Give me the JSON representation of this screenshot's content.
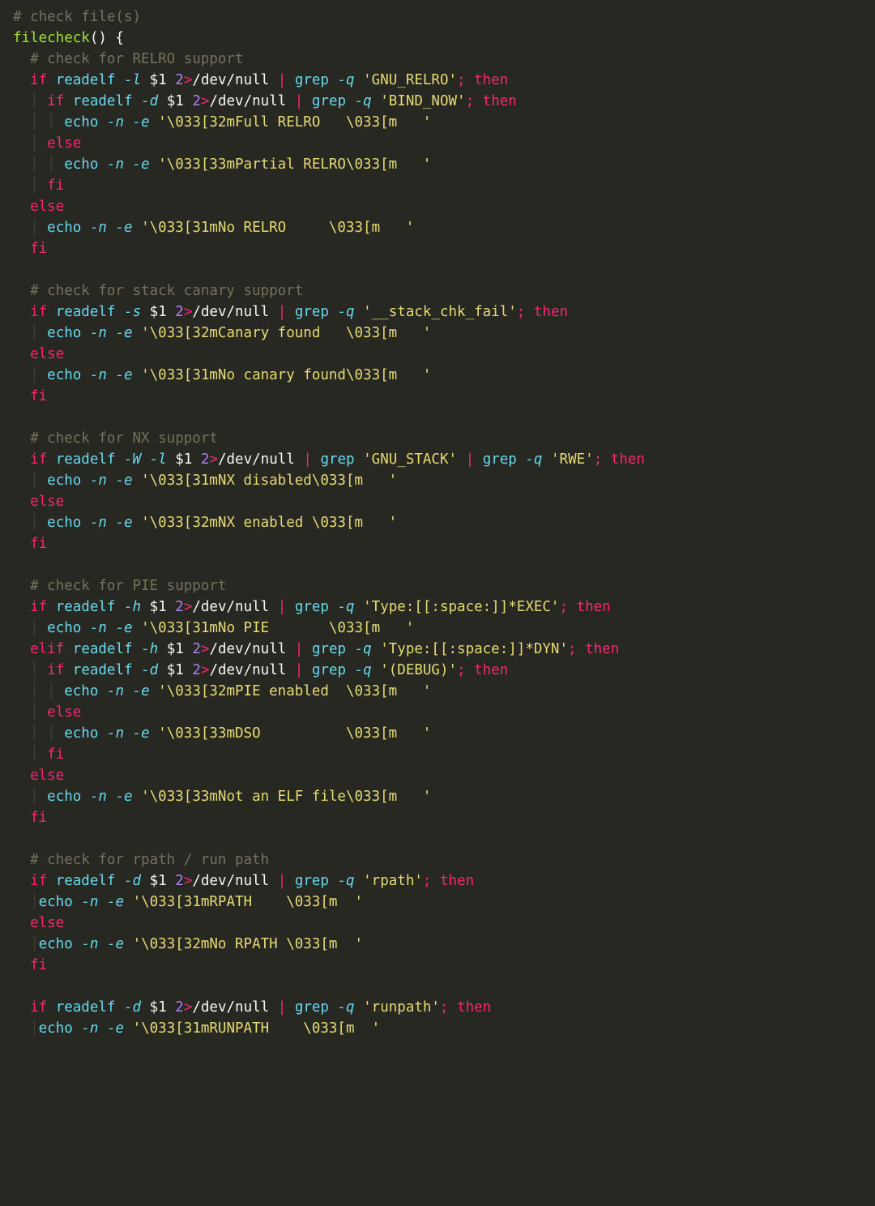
{
  "lines": [
    [
      [
        "c-comment",
        "# check file(s)"
      ]
    ],
    [
      [
        "c-func",
        "filecheck"
      ],
      [
        "c-white",
        "() {"
      ]
    ],
    [
      [
        "guide",
        "  "
      ],
      [
        "c-comment",
        "# check for RELRO support"
      ]
    ],
    [
      [
        "guide",
        "  "
      ],
      [
        "c-kw",
        "if"
      ],
      [
        "c-white",
        " "
      ],
      [
        "c-cmd",
        "readelf"
      ],
      [
        "c-white",
        " "
      ],
      [
        "c-flag",
        "-l"
      ],
      [
        "c-white",
        " "
      ],
      [
        "c-var",
        "$1"
      ],
      [
        "c-white",
        " "
      ],
      [
        "c-num",
        "2"
      ],
      [
        "c-op",
        ">"
      ],
      [
        "c-white",
        "/dev/null "
      ],
      [
        "c-op",
        "|"
      ],
      [
        "c-white",
        " "
      ],
      [
        "c-cmd",
        "grep"
      ],
      [
        "c-white",
        " "
      ],
      [
        "c-flag",
        "-q"
      ],
      [
        "c-white",
        " "
      ],
      [
        "c-str",
        "'GNU_RELRO'"
      ],
      [
        "c-op",
        ";"
      ],
      [
        "c-white",
        " "
      ],
      [
        "c-kw",
        "then"
      ]
    ],
    [
      [
        "guide",
        "  | "
      ],
      [
        "c-kw",
        "if"
      ],
      [
        "c-white",
        " "
      ],
      [
        "c-cmd",
        "readelf"
      ],
      [
        "c-white",
        " "
      ],
      [
        "c-flag",
        "-d"
      ],
      [
        "c-white",
        " "
      ],
      [
        "c-var",
        "$1"
      ],
      [
        "c-white",
        " "
      ],
      [
        "c-num",
        "2"
      ],
      [
        "c-op",
        ">"
      ],
      [
        "c-white",
        "/dev/null "
      ],
      [
        "c-op",
        "|"
      ],
      [
        "c-white",
        " "
      ],
      [
        "c-cmd",
        "grep"
      ],
      [
        "c-white",
        " "
      ],
      [
        "c-flag",
        "-q"
      ],
      [
        "c-white",
        " "
      ],
      [
        "c-str",
        "'BIND_NOW'"
      ],
      [
        "c-op",
        ";"
      ],
      [
        "c-white",
        " "
      ],
      [
        "c-kw",
        "then"
      ]
    ],
    [
      [
        "guide",
        "  | | "
      ],
      [
        "c-cmd",
        "echo"
      ],
      [
        "c-white",
        " "
      ],
      [
        "c-flag",
        "-n"
      ],
      [
        "c-white",
        " "
      ],
      [
        "c-flag",
        "-e"
      ],
      [
        "c-white",
        " "
      ],
      [
        "c-str",
        "'\\033[32mFull RELRO   \\033[m   '"
      ]
    ],
    [
      [
        "guide",
        "  | "
      ],
      [
        "c-kw",
        "else"
      ]
    ],
    [
      [
        "guide",
        "  | | "
      ],
      [
        "c-cmd",
        "echo"
      ],
      [
        "c-white",
        " "
      ],
      [
        "c-flag",
        "-n"
      ],
      [
        "c-white",
        " "
      ],
      [
        "c-flag",
        "-e"
      ],
      [
        "c-white",
        " "
      ],
      [
        "c-str",
        "'\\033[33mPartial RELRO\\033[m   '"
      ]
    ],
    [
      [
        "guide",
        "  | "
      ],
      [
        "c-kw",
        "fi"
      ]
    ],
    [
      [
        "guide",
        "  "
      ],
      [
        "c-kw",
        "else"
      ]
    ],
    [
      [
        "guide",
        "  | "
      ],
      [
        "c-cmd",
        "echo"
      ],
      [
        "c-white",
        " "
      ],
      [
        "c-flag",
        "-n"
      ],
      [
        "c-white",
        " "
      ],
      [
        "c-flag",
        "-e"
      ],
      [
        "c-white",
        " "
      ],
      [
        "c-str",
        "'\\033[31mNo RELRO     \\033[m   '"
      ]
    ],
    [
      [
        "guide",
        "  "
      ],
      [
        "c-kw",
        "fi"
      ]
    ],
    [
      [
        "c-white",
        " "
      ]
    ],
    [
      [
        "guide",
        "  "
      ],
      [
        "c-comment",
        "# check for stack canary support"
      ]
    ],
    [
      [
        "guide",
        "  "
      ],
      [
        "c-kw",
        "if"
      ],
      [
        "c-white",
        " "
      ],
      [
        "c-cmd",
        "readelf"
      ],
      [
        "c-white",
        " "
      ],
      [
        "c-flag",
        "-s"
      ],
      [
        "c-white",
        " "
      ],
      [
        "c-var",
        "$1"
      ],
      [
        "c-white",
        " "
      ],
      [
        "c-num",
        "2"
      ],
      [
        "c-op",
        ">"
      ],
      [
        "c-white",
        "/dev/null "
      ],
      [
        "c-op",
        "|"
      ],
      [
        "c-white",
        " "
      ],
      [
        "c-cmd",
        "grep"
      ],
      [
        "c-white",
        " "
      ],
      [
        "c-flag",
        "-q"
      ],
      [
        "c-white",
        " "
      ],
      [
        "c-str",
        "'__stack_chk_fail'"
      ],
      [
        "c-op",
        ";"
      ],
      [
        "c-white",
        " "
      ],
      [
        "c-kw",
        "then"
      ]
    ],
    [
      [
        "guide",
        "  | "
      ],
      [
        "c-cmd",
        "echo"
      ],
      [
        "c-white",
        " "
      ],
      [
        "c-flag",
        "-n"
      ],
      [
        "c-white",
        " "
      ],
      [
        "c-flag",
        "-e"
      ],
      [
        "c-white",
        " "
      ],
      [
        "c-str",
        "'\\033[32mCanary found   \\033[m   '"
      ]
    ],
    [
      [
        "guide",
        "  "
      ],
      [
        "c-kw",
        "else"
      ]
    ],
    [
      [
        "guide",
        "  | "
      ],
      [
        "c-cmd",
        "echo"
      ],
      [
        "c-white",
        " "
      ],
      [
        "c-flag",
        "-n"
      ],
      [
        "c-white",
        " "
      ],
      [
        "c-flag",
        "-e"
      ],
      [
        "c-white",
        " "
      ],
      [
        "c-str",
        "'\\033[31mNo canary found\\033[m   '"
      ]
    ],
    [
      [
        "guide",
        "  "
      ],
      [
        "c-kw",
        "fi"
      ]
    ],
    [
      [
        "c-white",
        " "
      ]
    ],
    [
      [
        "guide",
        "  "
      ],
      [
        "c-comment",
        "# check for NX support"
      ]
    ],
    [
      [
        "guide",
        "  "
      ],
      [
        "c-kw",
        "if"
      ],
      [
        "c-white",
        " "
      ],
      [
        "c-cmd",
        "readelf"
      ],
      [
        "c-white",
        " "
      ],
      [
        "c-flag",
        "-W"
      ],
      [
        "c-white",
        " "
      ],
      [
        "c-flag",
        "-l"
      ],
      [
        "c-white",
        " "
      ],
      [
        "c-var",
        "$1"
      ],
      [
        "c-white",
        " "
      ],
      [
        "c-num",
        "2"
      ],
      [
        "c-op",
        ">"
      ],
      [
        "c-white",
        "/dev/null "
      ],
      [
        "c-op",
        "|"
      ],
      [
        "c-white",
        " "
      ],
      [
        "c-cmd",
        "grep"
      ],
      [
        "c-white",
        " "
      ],
      [
        "c-str",
        "'GNU_STACK'"
      ],
      [
        "c-white",
        " "
      ],
      [
        "c-op",
        "|"
      ],
      [
        "c-white",
        " "
      ],
      [
        "c-cmd",
        "grep"
      ],
      [
        "c-white",
        " "
      ],
      [
        "c-flag",
        "-q"
      ],
      [
        "c-white",
        " "
      ],
      [
        "c-str",
        "'RWE'"
      ],
      [
        "c-op",
        ";"
      ],
      [
        "c-white",
        " "
      ],
      [
        "c-kw",
        "then"
      ]
    ],
    [
      [
        "guide",
        "  | "
      ],
      [
        "c-cmd",
        "echo"
      ],
      [
        "c-white",
        " "
      ],
      [
        "c-flag",
        "-n"
      ],
      [
        "c-white",
        " "
      ],
      [
        "c-flag",
        "-e"
      ],
      [
        "c-white",
        " "
      ],
      [
        "c-str",
        "'\\033[31mNX disabled\\033[m   '"
      ]
    ],
    [
      [
        "guide",
        "  "
      ],
      [
        "c-kw",
        "else"
      ]
    ],
    [
      [
        "guide",
        "  | "
      ],
      [
        "c-cmd",
        "echo"
      ],
      [
        "c-white",
        " "
      ],
      [
        "c-flag",
        "-n"
      ],
      [
        "c-white",
        " "
      ],
      [
        "c-flag",
        "-e"
      ],
      [
        "c-white",
        " "
      ],
      [
        "c-str",
        "'\\033[32mNX enabled \\033[m   '"
      ]
    ],
    [
      [
        "guide",
        "  "
      ],
      [
        "c-kw",
        "fi"
      ]
    ],
    [
      [
        "c-white",
        " "
      ]
    ],
    [
      [
        "guide",
        "  "
      ],
      [
        "c-comment",
        "# check for PIE support"
      ]
    ],
    [
      [
        "guide",
        "  "
      ],
      [
        "c-kw",
        "if"
      ],
      [
        "c-white",
        " "
      ],
      [
        "c-cmd",
        "readelf"
      ],
      [
        "c-white",
        " "
      ],
      [
        "c-flag",
        "-h"
      ],
      [
        "c-white",
        " "
      ],
      [
        "c-var",
        "$1"
      ],
      [
        "c-white",
        " "
      ],
      [
        "c-num",
        "2"
      ],
      [
        "c-op",
        ">"
      ],
      [
        "c-white",
        "/dev/null "
      ],
      [
        "c-op",
        "|"
      ],
      [
        "c-white",
        " "
      ],
      [
        "c-cmd",
        "grep"
      ],
      [
        "c-white",
        " "
      ],
      [
        "c-flag",
        "-q"
      ],
      [
        "c-white",
        " "
      ],
      [
        "c-str",
        "'Type:[[:space:]]*EXEC'"
      ],
      [
        "c-op",
        ";"
      ],
      [
        "c-white",
        " "
      ],
      [
        "c-kw",
        "then"
      ]
    ],
    [
      [
        "guide",
        "  | "
      ],
      [
        "c-cmd",
        "echo"
      ],
      [
        "c-white",
        " "
      ],
      [
        "c-flag",
        "-n"
      ],
      [
        "c-white",
        " "
      ],
      [
        "c-flag",
        "-e"
      ],
      [
        "c-white",
        " "
      ],
      [
        "c-str",
        "'\\033[31mNo PIE       \\033[m   '"
      ]
    ],
    [
      [
        "guide",
        "  "
      ],
      [
        "c-kw",
        "elif"
      ],
      [
        "c-white",
        " "
      ],
      [
        "c-cmd",
        "readelf"
      ],
      [
        "c-white",
        " "
      ],
      [
        "c-flag",
        "-h"
      ],
      [
        "c-white",
        " "
      ],
      [
        "c-var",
        "$1"
      ],
      [
        "c-white",
        " "
      ],
      [
        "c-num",
        "2"
      ],
      [
        "c-op",
        ">"
      ],
      [
        "c-white",
        "/dev/null "
      ],
      [
        "c-op",
        "|"
      ],
      [
        "c-white",
        " "
      ],
      [
        "c-cmd",
        "grep"
      ],
      [
        "c-white",
        " "
      ],
      [
        "c-flag",
        "-q"
      ],
      [
        "c-white",
        " "
      ],
      [
        "c-str",
        "'Type:[[:space:]]*DYN'"
      ],
      [
        "c-op",
        ";"
      ],
      [
        "c-white",
        " "
      ],
      [
        "c-kw",
        "then"
      ]
    ],
    [
      [
        "guide",
        "  | "
      ],
      [
        "c-kw",
        "if"
      ],
      [
        "c-white",
        " "
      ],
      [
        "c-cmd",
        "readelf"
      ],
      [
        "c-white",
        " "
      ],
      [
        "c-flag",
        "-d"
      ],
      [
        "c-white",
        " "
      ],
      [
        "c-var",
        "$1"
      ],
      [
        "c-white",
        " "
      ],
      [
        "c-num",
        "2"
      ],
      [
        "c-op",
        ">"
      ],
      [
        "c-white",
        "/dev/null "
      ],
      [
        "c-op",
        "|"
      ],
      [
        "c-white",
        " "
      ],
      [
        "c-cmd",
        "grep"
      ],
      [
        "c-white",
        " "
      ],
      [
        "c-flag",
        "-q"
      ],
      [
        "c-white",
        " "
      ],
      [
        "c-str",
        "'(DEBUG)'"
      ],
      [
        "c-op",
        ";"
      ],
      [
        "c-white",
        " "
      ],
      [
        "c-kw",
        "then"
      ]
    ],
    [
      [
        "guide",
        "  | | "
      ],
      [
        "c-cmd",
        "echo"
      ],
      [
        "c-white",
        " "
      ],
      [
        "c-flag",
        "-n"
      ],
      [
        "c-white",
        " "
      ],
      [
        "c-flag",
        "-e"
      ],
      [
        "c-white",
        " "
      ],
      [
        "c-str",
        "'\\033[32mPIE enabled  \\033[m   '"
      ]
    ],
    [
      [
        "guide",
        "  | "
      ],
      [
        "c-kw",
        "else"
      ]
    ],
    [
      [
        "guide",
        "  | | "
      ],
      [
        "c-cmd",
        "echo"
      ],
      [
        "c-white",
        " "
      ],
      [
        "c-flag",
        "-n"
      ],
      [
        "c-white",
        " "
      ],
      [
        "c-flag",
        "-e"
      ],
      [
        "c-white",
        " "
      ],
      [
        "c-str",
        "'\\033[33mDSO          \\033[m   '"
      ]
    ],
    [
      [
        "guide",
        "  | "
      ],
      [
        "c-kw",
        "fi"
      ]
    ],
    [
      [
        "guide",
        "  "
      ],
      [
        "c-kw",
        "else"
      ]
    ],
    [
      [
        "guide",
        "  | "
      ],
      [
        "c-cmd",
        "echo"
      ],
      [
        "c-white",
        " "
      ],
      [
        "c-flag",
        "-n"
      ],
      [
        "c-white",
        " "
      ],
      [
        "c-flag",
        "-e"
      ],
      [
        "c-white",
        " "
      ],
      [
        "c-str",
        "'\\033[33mNot an ELF file\\033[m   '"
      ]
    ],
    [
      [
        "guide",
        "  "
      ],
      [
        "c-kw",
        "fi"
      ]
    ],
    [
      [
        "c-white",
        " "
      ]
    ],
    [
      [
        "guide",
        "  "
      ],
      [
        "c-comment",
        "# check for rpath / run path"
      ]
    ],
    [
      [
        "guide",
        "  "
      ],
      [
        "c-kw",
        "if"
      ],
      [
        "c-white",
        " "
      ],
      [
        "c-cmd",
        "readelf"
      ],
      [
        "c-white",
        " "
      ],
      [
        "c-flag",
        "-d"
      ],
      [
        "c-white",
        " "
      ],
      [
        "c-var",
        "$1"
      ],
      [
        "c-white",
        " "
      ],
      [
        "c-num",
        "2"
      ],
      [
        "c-op",
        ">"
      ],
      [
        "c-white",
        "/dev/null "
      ],
      [
        "c-op",
        "|"
      ],
      [
        "c-white",
        " "
      ],
      [
        "c-cmd",
        "grep"
      ],
      [
        "c-white",
        " "
      ],
      [
        "c-flag",
        "-q"
      ],
      [
        "c-white",
        " "
      ],
      [
        "c-str",
        "'rpath'"
      ],
      [
        "c-op",
        ";"
      ],
      [
        "c-white",
        " "
      ],
      [
        "c-kw",
        "then"
      ]
    ],
    [
      [
        "guide",
        "  |"
      ],
      [
        "c-cmd",
        "echo"
      ],
      [
        "c-white",
        " "
      ],
      [
        "c-flag",
        "-n"
      ],
      [
        "c-white",
        " "
      ],
      [
        "c-flag",
        "-e"
      ],
      [
        "c-white",
        " "
      ],
      [
        "c-str",
        "'\\033[31mRPATH    \\033[m  '"
      ]
    ],
    [
      [
        "guide",
        "  "
      ],
      [
        "c-kw",
        "else"
      ]
    ],
    [
      [
        "guide",
        "  |"
      ],
      [
        "c-cmd",
        "echo"
      ],
      [
        "c-white",
        " "
      ],
      [
        "c-flag",
        "-n"
      ],
      [
        "c-white",
        " "
      ],
      [
        "c-flag",
        "-e"
      ],
      [
        "c-white",
        " "
      ],
      [
        "c-str",
        "'\\033[32mNo RPATH \\033[m  '"
      ]
    ],
    [
      [
        "guide",
        "  "
      ],
      [
        "c-kw",
        "fi"
      ]
    ],
    [
      [
        "c-white",
        " "
      ]
    ],
    [
      [
        "guide",
        "  "
      ],
      [
        "c-kw",
        "if"
      ],
      [
        "c-white",
        " "
      ],
      [
        "c-cmd",
        "readelf"
      ],
      [
        "c-white",
        " "
      ],
      [
        "c-flag",
        "-d"
      ],
      [
        "c-white",
        " "
      ],
      [
        "c-var",
        "$1"
      ],
      [
        "c-white",
        " "
      ],
      [
        "c-num",
        "2"
      ],
      [
        "c-op",
        ">"
      ],
      [
        "c-white",
        "/dev/null "
      ],
      [
        "c-op",
        "|"
      ],
      [
        "c-white",
        " "
      ],
      [
        "c-cmd",
        "grep"
      ],
      [
        "c-white",
        " "
      ],
      [
        "c-flag",
        "-q"
      ],
      [
        "c-white",
        " "
      ],
      [
        "c-str",
        "'runpath'"
      ],
      [
        "c-op",
        ";"
      ],
      [
        "c-white",
        " "
      ],
      [
        "c-kw",
        "then"
      ]
    ],
    [
      [
        "guide",
        "  |"
      ],
      [
        "c-cmd",
        "echo"
      ],
      [
        "c-white",
        " "
      ],
      [
        "c-flag",
        "-n"
      ],
      [
        "c-white",
        " "
      ],
      [
        "c-flag",
        "-e"
      ],
      [
        "c-white",
        " "
      ],
      [
        "c-str",
        "'\\033[31mRUNPATH    \\033[m  '"
      ]
    ]
  ]
}
